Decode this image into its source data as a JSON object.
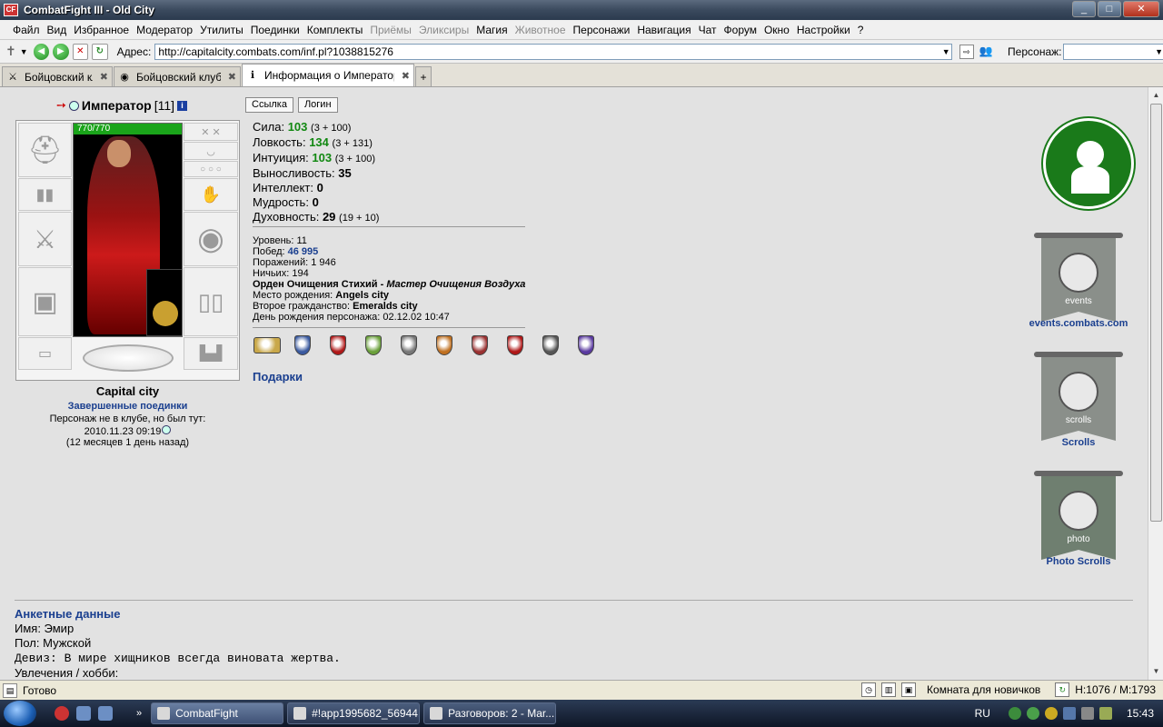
{
  "window": {
    "title": "CombatFight III - Old City",
    "app_icon_text": "CF"
  },
  "menu": [
    {
      "label": "Файл",
      "disabled": false
    },
    {
      "label": "Вид",
      "disabled": false
    },
    {
      "label": "Избранное",
      "disabled": false
    },
    {
      "label": "Модератор",
      "disabled": false
    },
    {
      "label": "Утилиты",
      "disabled": false
    },
    {
      "label": "Поединки",
      "disabled": false
    },
    {
      "label": "Комплекты",
      "disabled": false
    },
    {
      "label": "Приёмы",
      "disabled": true
    },
    {
      "label": "Эликсиры",
      "disabled": true
    },
    {
      "label": "Магия",
      "disabled": false
    },
    {
      "label": "Животное",
      "disabled": true
    },
    {
      "label": "Персонажи",
      "disabled": false
    },
    {
      "label": "Навигация",
      "disabled": false
    },
    {
      "label": "Чат",
      "disabled": false
    },
    {
      "label": "Форум",
      "disabled": false
    },
    {
      "label": "Окно",
      "disabled": false
    },
    {
      "label": "Настройки",
      "disabled": false
    },
    {
      "label": "?",
      "disabled": false
    }
  ],
  "address": {
    "label": "Адрес:",
    "url": "http://capitalcity.combats.com/inf.pl?1038815276",
    "persona_label": "Персонаж:"
  },
  "tabs": [
    {
      "label": "Бойцовский клуб",
      "active": false
    },
    {
      "label": "Бойцовский клуб.",
      "active": false
    },
    {
      "label": "Информация о Император",
      "active": true
    }
  ],
  "character": {
    "name": "Император",
    "level": "[11]",
    "hp": "770/770",
    "city": "Capital city",
    "finished_fights": "Завершенные поединки",
    "not_in_club": "Персонаж не в клубе, но был тут:",
    "last_seen": "2010.11.23 09:19",
    "ago": "(12 месяцев 1 день назад)"
  },
  "buttons": {
    "link": "Ссылка",
    "login": "Логин"
  },
  "stats": [
    {
      "label": "Сила:",
      "value": "103",
      "green": true,
      "sub": "(3 + 100)"
    },
    {
      "label": "Ловкость:",
      "value": "134",
      "green": true,
      "sub": "(3 + 131)"
    },
    {
      "label": "Интуиция:",
      "value": "103",
      "green": true,
      "sub": "(3 + 100)"
    },
    {
      "label": "Выносливость:",
      "value": "35",
      "green": false,
      "sub": ""
    },
    {
      "label": "Интеллект:",
      "value": "0",
      "green": false,
      "sub": ""
    },
    {
      "label": "Мудрость:",
      "value": "0",
      "green": false,
      "sub": ""
    },
    {
      "label": "Духовность:",
      "value": "29",
      "green": false,
      "sub": "(19 + 10)"
    }
  ],
  "details": {
    "level_label": "Уровень:",
    "level": "11",
    "wins_label": "Побед:",
    "wins": "46 995",
    "losses_label": "Поражений:",
    "losses": "1 946",
    "draws_label": "Ничьих:",
    "draws": "194",
    "order": "Орден Очищения Стихий",
    "order_sep": " - ",
    "order_rank": "Мастер Очищения Воздуха",
    "birthplace_label": "Место рождения:",
    "birthplace": "Angels city",
    "second_cit_label": "Второе гражданство:",
    "second_cit": "Emeralds city",
    "birthday_label": "День рождения персонажа:",
    "birthday": "02.12.02 10:47"
  },
  "badge_colors": [
    "#c9a84a",
    "#3a5aa0",
    "#b01818",
    "#6aa03a",
    "#777777",
    "#c07020",
    "#9a3030",
    "#b01818",
    "#555555",
    "#5a3aa0"
  ],
  "gifts": "Подарки",
  "side": {
    "events_label": "events.combats.com",
    "events_text": "events",
    "scrolls_label": "Scrolls",
    "scrolls_text": "scrolls",
    "photo_label": "Photo Scrolls",
    "photo_text": "photo"
  },
  "profile": {
    "title": "Анкетные данные",
    "name": "Имя: Эмир",
    "gender": "Пол: Мужской",
    "motto": "Девиз: В мире хищников всегда виновата жертва.",
    "hobby": "Увлечения / хобби:"
  },
  "status": {
    "ready": "Готово",
    "room": "Комната для новичков",
    "hp_mana": "H:1076 / M:1793"
  },
  "taskbar": {
    "tasks": [
      "CombatFight",
      "#!app1995682_56944...",
      "Разговоров: 2 - Mar..."
    ],
    "lang": "RU",
    "time": "15:43"
  }
}
